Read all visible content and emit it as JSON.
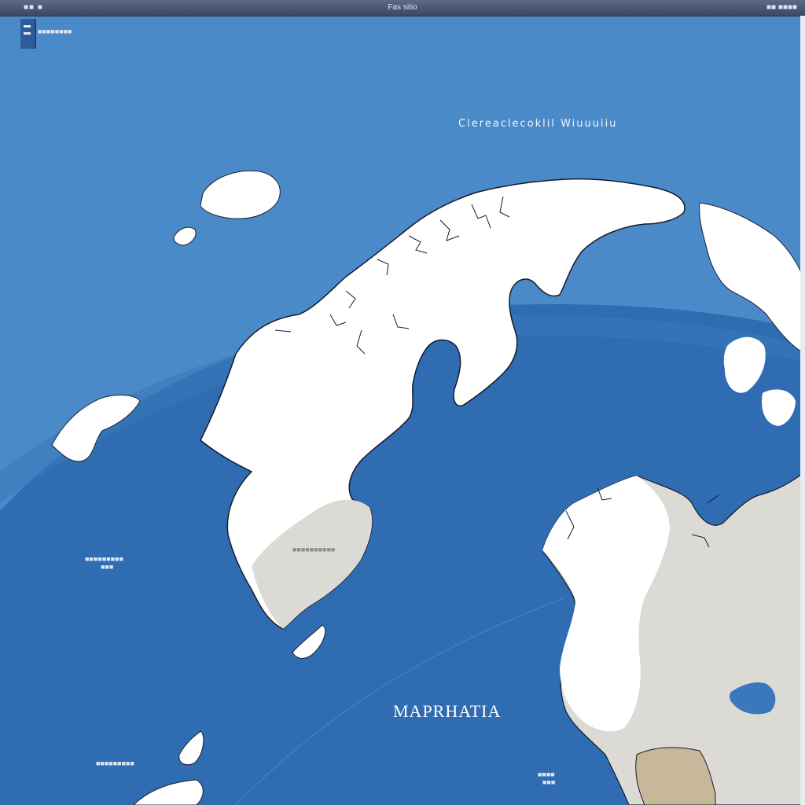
{
  "window": {
    "left_title": "■■ ■",
    "center_title": "Fas sitio",
    "right_title": "■■ ■■■■"
  },
  "toolbar": {
    "corner_label": "■■■■■■■■"
  },
  "map": {
    "ocean_title": "Clereaclecoklil Wiuuuiiu",
    "big_label": "MAPRHATIA",
    "label_west": "■■■■■■■■■",
    "label_west_sub": "■■■",
    "label_land_center": "■■■■■■■■■■",
    "label_south_left": "■■■■■■■■■",
    "label_south_right": "■■■■",
    "label_south_right_sub": "■■■",
    "colors": {
      "ocean": "#3f7fc0",
      "deep_ocean": "#2f6cb1",
      "ice": "#ffffff",
      "land": "#dcdad4",
      "coast": "#111a2a"
    }
  }
}
